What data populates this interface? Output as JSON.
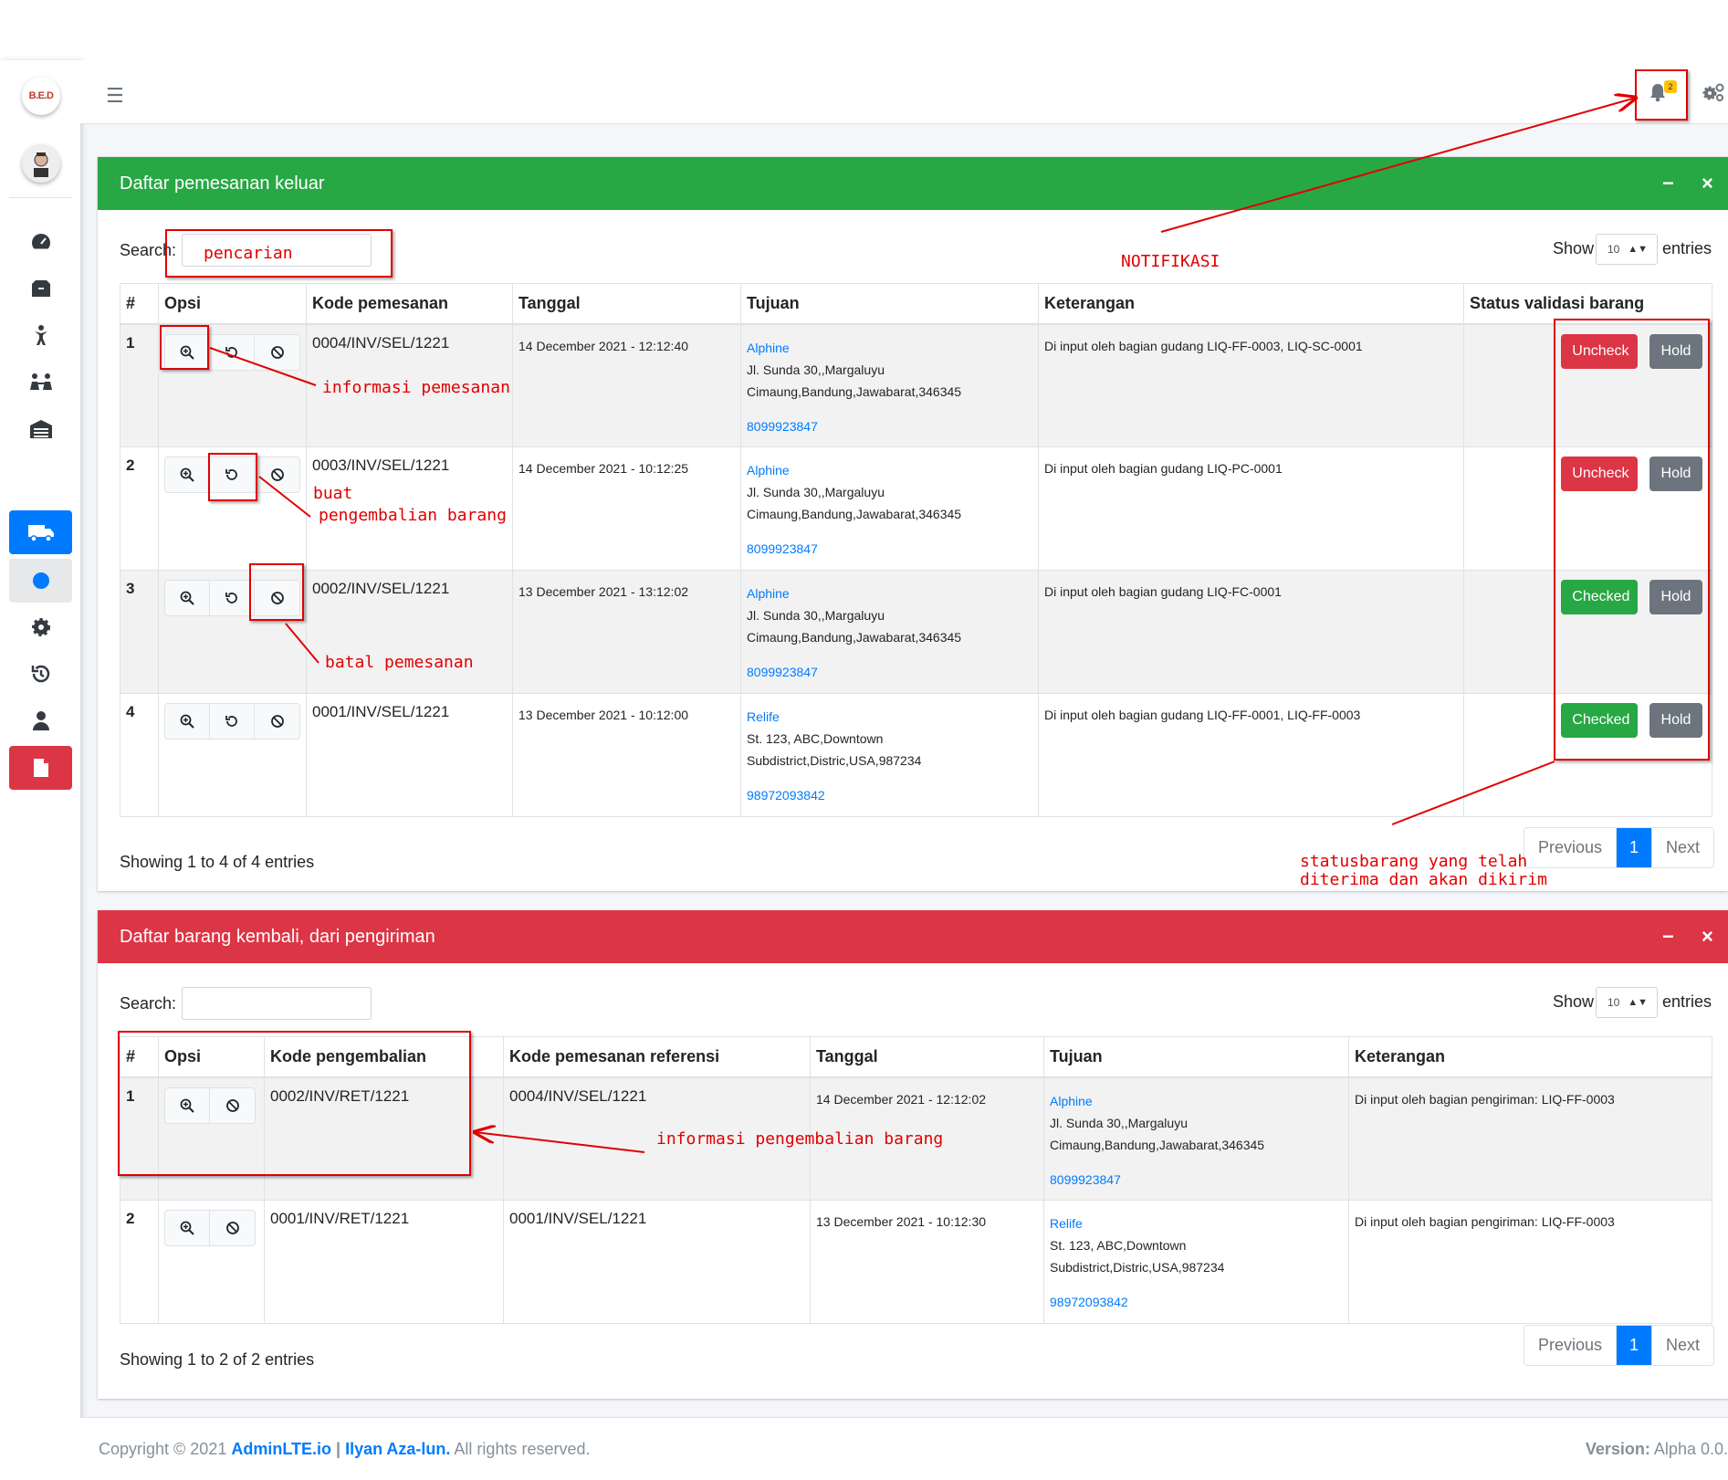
{
  "app": {
    "logo": "B.E.D"
  },
  "sidebar": {
    "items": [
      {
        "icon": "tachometer-icon"
      },
      {
        "icon": "boxes-icon"
      },
      {
        "icon": "person-icon"
      },
      {
        "icon": "people-icon"
      },
      {
        "icon": "warehouse-icon"
      },
      {
        "icon": "truck-icon"
      },
      {
        "icon": "circle-icon"
      },
      {
        "icon": "gear-icon"
      },
      {
        "icon": "history-icon"
      },
      {
        "icon": "user-icon"
      },
      {
        "icon": "file-icon"
      }
    ]
  },
  "navbar": {
    "notification_count": "2"
  },
  "orders": {
    "title": "Daftar pemesanan keluar",
    "search_label": "Search:",
    "search_value": "pencarian",
    "show_label": "Show",
    "show_value": "10",
    "entries_label": "entries",
    "headers": [
      "#",
      "Opsi",
      "Kode pemesanan",
      "Tanggal",
      "Tujuan",
      "Keterangan",
      "Status validasi barang"
    ],
    "rows": [
      {
        "num": "1",
        "code": "0004/INV/SEL/1221",
        "date": "14 December 2021 - 12:12:40",
        "dest_name": "Alphine",
        "addr1": "Jl. Sunda 30,,Margaluyu",
        "addr2": "Cimaung,Bandung,Jawabarat,346345",
        "phone": "8099923847",
        "note": "Di input oleh bagian gudang LIQ-FF-0003, LIQ-SC-0001",
        "status": "Uncheck",
        "hold": "Hold"
      },
      {
        "num": "2",
        "code": "0003/INV/SEL/1221",
        "date": "14 December 2021 - 10:12:25",
        "dest_name": "Alphine",
        "addr1": "Jl. Sunda 30,,Margaluyu",
        "addr2": "Cimaung,Bandung,Jawabarat,346345",
        "phone": "8099923847",
        "note": "Di input oleh bagian gudang LIQ-PC-0001",
        "status": "Uncheck",
        "hold": "Hold"
      },
      {
        "num": "3",
        "code": "0002/INV/SEL/1221",
        "date": "13 December 2021 - 13:12:02",
        "dest_name": "Alphine",
        "addr1": "Jl. Sunda 30,,Margaluyu",
        "addr2": "Cimaung,Bandung,Jawabarat,346345",
        "phone": "8099923847",
        "note": "Di input oleh bagian gudang LIQ-FC-0001",
        "status": "Checked",
        "hold": "Hold"
      },
      {
        "num": "4",
        "code": "0001/INV/SEL/1221",
        "date": "13 December 2021 - 10:12:00",
        "dest_name": "Relife",
        "addr1": "St. 123, ABC,Downtown",
        "addr2": "Subdistrict,Distric,USA,987234",
        "phone": "98972093842",
        "note": "Di input oleh bagian gudang LIQ-FF-0001, LIQ-FF-0003",
        "status": "Checked",
        "hold": "Hold"
      }
    ],
    "info": "Showing 1 to 4 of 4 entries",
    "pager": {
      "prev": "Previous",
      "page": "1",
      "next": "Next"
    }
  },
  "returns": {
    "title": "Daftar barang kembali, dari pengiriman",
    "search_label": "Search:",
    "show_label": "Show",
    "show_value": "10",
    "entries_label": "entries",
    "headers": [
      "#",
      "Opsi",
      "Kode pengembalian",
      "Kode pemesanan referensi",
      "Tanggal",
      "Tujuan",
      "Keterangan"
    ],
    "rows": [
      {
        "num": "1",
        "code": "0002/INV/RET/1221",
        "ref": "0004/INV/SEL/1221",
        "date": "14 December 2021 - 12:12:02",
        "dest_name": "Alphine",
        "addr1": "Jl. Sunda 30,,Margaluyu",
        "addr2": "Cimaung,Bandung,Jawabarat,346345",
        "phone": "8099923847",
        "note": "Di input oleh bagian pengiriman: LIQ-FF-0003"
      },
      {
        "num": "2",
        "code": "0001/INV/RET/1221",
        "ref": "0001/INV/SEL/1221",
        "date": "13 December 2021 - 10:12:30",
        "dest_name": "Relife",
        "addr1": "St. 123, ABC,Downtown",
        "addr2": "Subdistrict,Distric,USA,987234",
        "phone": "98972093842",
        "note": "Di input oleh bagian pengiriman: LIQ-FF-0003"
      }
    ],
    "info": "Showing 1 to 2 of 2 entries",
    "pager": {
      "prev": "Previous",
      "page": "1",
      "next": "Next"
    }
  },
  "footer": {
    "copyright": "Copyright © 2021 ",
    "link1": "AdminLTE.io",
    "sep": " | ",
    "link2": "Ilyan Aza-lun.",
    "rights": " All rights reserved.",
    "version_label": "Version:",
    "version": " Alpha 0.0."
  },
  "annotations": {
    "notifikasi": "NOTIFIKASI",
    "informasi_pemesanan": "informasi pemesanan",
    "buat": "buat",
    "pengembalian_barang": "pengembalian barang",
    "batal_pemesanan": "batal pemesanan",
    "status_line1": "statusbarang yang telah",
    "status_line2": "diterima dan akan dikirim",
    "informasi_pengembalian": "informasi pengembalian barang"
  },
  "colors": {
    "green": "#28a745",
    "red": "#dc3545",
    "blue": "#007bff",
    "gray": "#6c757d",
    "annotation": "#e00000"
  }
}
